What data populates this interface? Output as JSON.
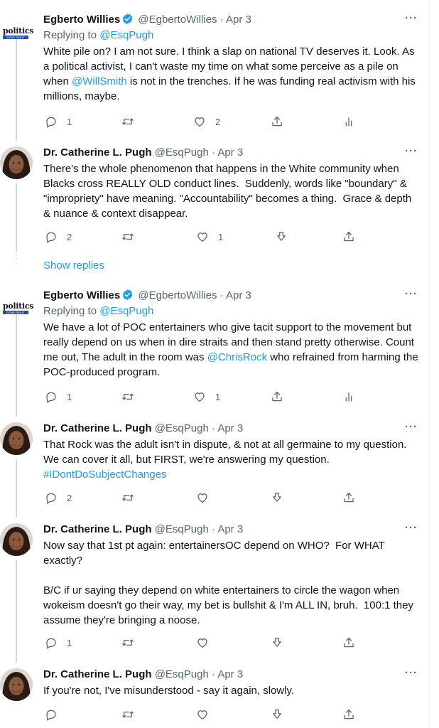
{
  "colors": {
    "link": "#1d9bf0",
    "muted": "#536471",
    "text": "#0f1419",
    "verified": "#1d9bf0"
  },
  "show_replies": "Show replies",
  "tweets": [
    {
      "name": "Egberto Willies",
      "handle": "@EgbertoWillies",
      "sep": "·",
      "date": "Apr 3",
      "more": "···",
      "avatar": {
        "logo_top": "politics",
        "logo_bottom": "DONE RIGHT"
      },
      "reply_prefix": "Replying to ",
      "reply_handle": "@EsqPugh",
      "text_parts": [
        "White pile on? I am not sure. I think a slap on national TV deserves it. Look. As a political activist, I can't waste my time on what some perceive as a pile on when ",
        "@WillSmith",
        " is not in the trenches. If he was funding real activism with his millions, maybe."
      ],
      "reply_count": "1",
      "retweet_count": "",
      "like_count": "2"
    },
    {
      "name": "Dr. Catherine L. Pugh",
      "handle": "@EsqPugh",
      "sep": "·",
      "date": "Apr 3",
      "more": "···",
      "text_parts": [
        "There's the whole phenomenon that happens in the White community when Blacks cross REALLY OLD conduct lines.  Suddenly, words like \"boundary\" & \"impropriety\" have meaning. \"Accountability\" becomes a thing.  Grace & depth & nuance & context disappear."
      ],
      "reply_count": "2",
      "retweet_count": "",
      "like_count": "1"
    },
    {
      "name": "Egberto Willies",
      "handle": "@EgbertoWillies",
      "sep": "·",
      "date": "Apr 3",
      "more": "···",
      "avatar": {
        "logo_top": "politics",
        "logo_bottom": "DONE RIGHT"
      },
      "reply_prefix": "Replying to ",
      "reply_handle": "@EsqPugh",
      "text_parts": [
        "We have a lot of POC entertainers who give tacit support to the movement but really depend on us when in dire straits and then stand pretty otherwise. Count me out, The adult in the room was ",
        "@ChrisRock",
        " who refrained from harming the POC-produced program."
      ],
      "reply_count": "1",
      "retweet_count": "",
      "like_count": "1"
    },
    {
      "name": "Dr. Catherine L. Pugh",
      "handle": "@EsqPugh",
      "sep": "·",
      "date": "Apr 3",
      "more": "···",
      "text_parts": [
        "That Rock was the adult isn't in dispute, & not at all germaine to my question.  We can cover it all, but FIRST, we're answering my question.\n",
        "#IDontDoSubjectChanges"
      ],
      "reply_count": "2",
      "retweet_count": "",
      "like_count": ""
    },
    {
      "name": "Dr. Catherine L. Pugh",
      "handle": "@EsqPugh",
      "sep": "·",
      "date": "Apr 3",
      "more": "···",
      "text_parts": [
        "Now say that 1st pt again: entertainersOC depend on WHO?  For WHAT exactly?\n\nB/C if ur saying they depend on white entertainers to circle the wagon when wokeism doesn't go their way, my bet is bullshit & I'm ALL IN, bruh.  100:1 they assume they're bringing a noose."
      ],
      "reply_count": "1",
      "retweet_count": "",
      "like_count": ""
    },
    {
      "name": "Dr. Catherine L. Pugh",
      "handle": "@EsqPugh",
      "sep": "·",
      "date": "Apr 3",
      "more": "···",
      "text_parts": [
        "If you're not, I've misunderstood - say it again, slowly."
      ],
      "reply_count": "",
      "retweet_count": "",
      "like_count": ""
    }
  ],
  "icons": {
    "reply": "reply-icon",
    "retweet": "retweet-icon",
    "like": "like-icon",
    "share": "share-icon",
    "analytics": "analytics-icon",
    "tip": "tip-icon",
    "verified": "verified-badge-icon"
  }
}
